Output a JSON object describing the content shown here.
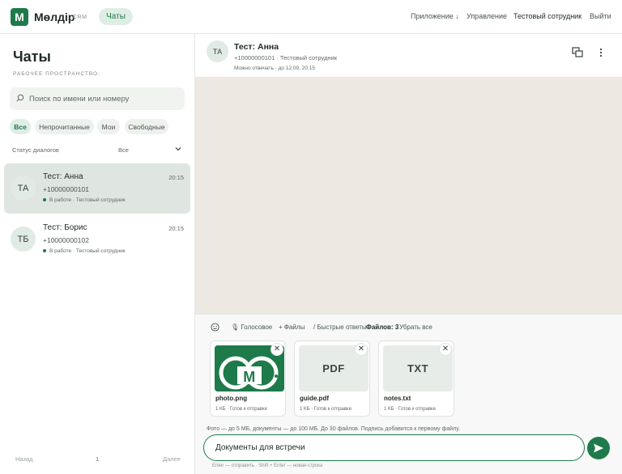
{
  "app": {
    "logo_letter": "M",
    "name": "Мөлдір",
    "sub": "CRM",
    "tab_chats": "Чаты"
  },
  "nav": {
    "app": "Приложение ↓",
    "manage": "Управление",
    "user": "Тестовый сотрудник",
    "logout": "Выйти"
  },
  "sidebar": {
    "title": "Чаты",
    "subtitle": "РАБОЧЕЕ ПРОСТРАНСТВО:",
    "search_placeholder": "Поиск по имени или номеру",
    "filters": [
      "Все",
      "Непрочитанные",
      "Мои",
      "Свободные"
    ],
    "status_label": "Статус диалогов",
    "status_value": "Все",
    "chats": [
      {
        "initials": "ТА",
        "name": "Тест: Анна",
        "phone": "+10000000101",
        "status": "В работе · Тестовый сотрудник",
        "time": "20:15"
      },
      {
        "initials": "ТБ",
        "name": "Тест: Борис",
        "phone": "+10000000102",
        "status": "В работе · Тестовый сотрудник",
        "time": "20:15"
      }
    ],
    "pager": {
      "prev": "Назад",
      "page": "1",
      "next": "Далее"
    }
  },
  "conversation": {
    "initials": "ТА",
    "name": "Тест: Анна",
    "meta": "+10000000101 · Тестовый сотрудник",
    "note": "Можно отвечать · до 12.09, 20:15"
  },
  "composer": {
    "voice": "🎙 Голосовое",
    "files": "+ Файлы",
    "quick": "/ Быстрые ответы",
    "count": "Файлов: 3",
    "remove_all": "Убрать все",
    "attachments": [
      {
        "name": "photo.png",
        "meta": "1 КБ · Готов к отправке",
        "thumb": ""
      },
      {
        "name": "guide.pdf",
        "meta": "1 КБ · Готов к отправке",
        "thumb": "PDF"
      },
      {
        "name": "notes.txt",
        "meta": "1 КБ · Готов к отправке",
        "thumb": "TXT"
      }
    ],
    "remove_glyph": "✕",
    "limits": "Фото — до 5 МБ, документы — до 100 МБ. До 30 файлов. Подпись добавится к первому файлу.",
    "message_value": "Документы для встречи",
    "hint": "Enter — отправить · Shift + Enter — новая строка"
  },
  "colors": {
    "accent": "#1e7a4a",
    "accent_soft": "#dfeee5",
    "chat_bg": "#eee8e3",
    "selected": "#dfe6e1"
  },
  "icons": [
    "search-icon",
    "chevron-down-icon",
    "switch-windows-icon",
    "more-vertical-icon",
    "emoji-icon",
    "microphone-icon",
    "close-icon",
    "send-icon"
  ]
}
